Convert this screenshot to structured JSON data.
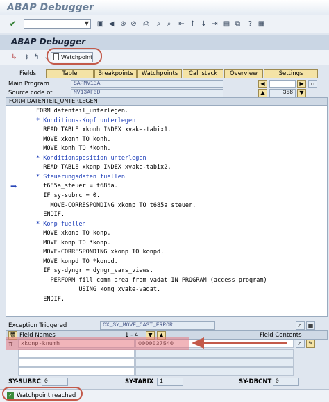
{
  "window": {
    "title": "ABAP Debugger"
  },
  "toolbar": {
    "command_field_value": "",
    "icons": [
      "enter-check-icon",
      "save-icon",
      "back-icon",
      "exit-icon",
      "cancel-icon",
      "print-icon",
      "find-icon",
      "find-next-icon",
      "first-page-icon",
      "prev-page-icon",
      "next-page-icon",
      "last-page-icon",
      "create-session-icon",
      "shortcut-icon",
      "help-icon",
      "layout-icon"
    ]
  },
  "debugger": {
    "title": "ABAP Debugger",
    "watchpoint_label": "Watchpoint"
  },
  "tabs": {
    "fields_label": "Fields",
    "items": [
      "Table",
      "Breakpoints",
      "Watchpoints",
      "Call stack",
      "Overview",
      "Settings"
    ]
  },
  "info": {
    "main_program_label": "Main Program",
    "main_program_value": "SAPMV13A",
    "source_code_label": "Source code of",
    "source_code_value": "MV13AF0D",
    "line_number": "358"
  },
  "source": {
    "header": "FORM DATENTEIL_UNTERLEGEN",
    "lines": [
      {
        "text": "FORM datenteil_unterlegen.",
        "comment": false
      },
      {
        "text": "* Konditions-Kopf unterlegen",
        "comment": true
      },
      {
        "text": "  READ TABLE xkonh INDEX xvake-tabix1.",
        "comment": false
      },
      {
        "text": "  MOVE xkonh TO konh.",
        "comment": false
      },
      {
        "text": "  MOVE konh TO *konh.",
        "comment": false
      },
      {
        "text": "* Konditionsposition unterlegen",
        "comment": true
      },
      {
        "text": "  READ TABLE xkonp INDEX xvake-tabix2.",
        "comment": false
      },
      {
        "text": "* Steuerungsdaten fuellen",
        "comment": true
      },
      {
        "text": "  t685a_steuer = t685a.",
        "comment": false
      },
      {
        "text": "  IF sy-subrc = 0.",
        "comment": false
      },
      {
        "text": "    MOVE-CORRESPONDING xkonp TO t685a_steuer.",
        "comment": false
      },
      {
        "text": "  ENDIF.",
        "comment": false
      },
      {
        "text": "* Konp fuellen",
        "comment": true
      },
      {
        "text": "  MOVE xkonp TO konp.",
        "comment": false
      },
      {
        "text": "  MOVE konp TO *konp.",
        "comment": false
      },
      {
        "text": "  MOVE-CORRESPONDING xkonp TO konpd.",
        "comment": false
      },
      {
        "text": "  MOVE konpd TO *konpd.",
        "comment": false
      },
      {
        "text": "  IF sy-dyngr = dyngr_vars_views.",
        "comment": false
      },
      {
        "text": "    PERFORM fill_comm_area_from_vadat IN PROGRAM (access_program)",
        "comment": false
      },
      {
        "text": "            USING komg xvake-vadat.",
        "comment": false
      },
      {
        "text": "  ENDIF.",
        "comment": false
      }
    ]
  },
  "exception": {
    "label": "Exception Triggered",
    "value": "CX_SY_MOVE_CAST_ERROR"
  },
  "field_table": {
    "names_header": "Field Names",
    "range": "1 - 4",
    "contents_header": "Field Contents",
    "rows": [
      {
        "name": "xkonp-knumh",
        "value": "0000037540"
      },
      {
        "name": "",
        "value": ""
      },
      {
        "name": "",
        "value": ""
      },
      {
        "name": "",
        "value": ""
      }
    ]
  },
  "system_fields": {
    "subrc_label": "SY-SUBRC",
    "subrc_value": "0",
    "tabix_label": "SY-TABIX",
    "tabix_value": "1",
    "dbcnt_label": "SY-DBCNT",
    "dbcnt_value": "0"
  },
  "status": {
    "message": "Watchpoint reached"
  },
  "colors": {
    "tab_yellow": "#f4e3a6",
    "annotation_red": "#c35a4a",
    "comment_blue": "#1c3db8"
  }
}
